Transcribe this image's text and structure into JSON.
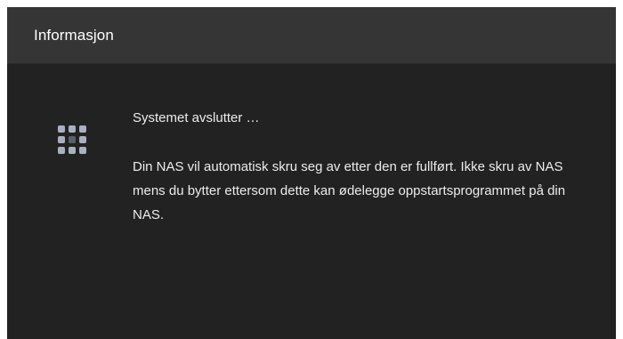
{
  "dialog": {
    "title": "Informasjon",
    "icon": "grid-spinner-icon",
    "status_text": "Systemet avslutter …",
    "detail_text": "Din NAS vil automatisk skru seg av etter den er fullført. Ikke skru av NAS mens du bytter ettersom dette kan ødelegge oppstartsprogrammet på din NAS."
  },
  "colors": {
    "header_background": "#353535",
    "body_background": "#222222",
    "text": "#ececec",
    "icon_light": "#a9b1c0",
    "icon_dark": "#5a5f68"
  }
}
